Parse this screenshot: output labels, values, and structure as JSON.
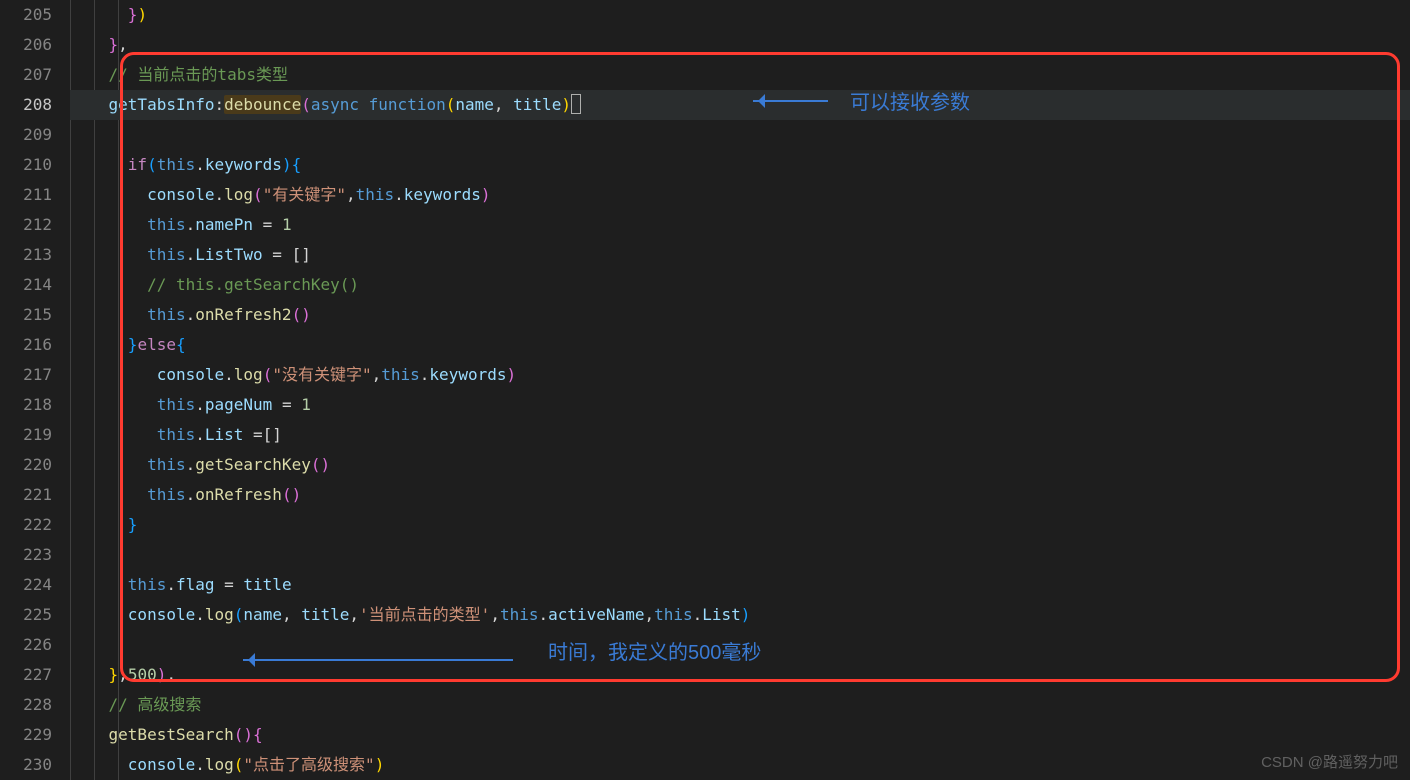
{
  "gutter": {
    "start": 205,
    "end": 230,
    "active": 208
  },
  "code": {
    "l205": "      })",
    "l206": "    },",
    "comment1": "// 当前点击的tabs类型",
    "l208_key": "getTabsInfo",
    "l208_fn": "debounce",
    "l208_async": "async",
    "l208_function": "function",
    "l208_p1": "name",
    "l208_p2": "title",
    "l210_if": "if",
    "l210_this": "this",
    "l210_kw": "keywords",
    "l211_console": "console",
    "l211_log": "log",
    "l211_str": "\"有关键字\"",
    "l211_this": "this",
    "l211_kw": "keywords",
    "l212_this": "this",
    "l212_prop": "namePn",
    "l212_eq": " = ",
    "l212_val": "1",
    "l213_this": "this",
    "l213_prop": "ListTwo",
    "l213_eq": " = ",
    "l213_val": "[]",
    "l214_comment": "// this.getSearchKey()",
    "l215_this": "this",
    "l215_fn": "onRefresh2",
    "l216_else": "else",
    "l217_console": "console",
    "l217_log": "log",
    "l217_str": "\"没有关键字\"",
    "l217_this": "this",
    "l217_kw": "keywords",
    "l218_this": "this",
    "l218_prop": "pageNum",
    "l218_eq": " = ",
    "l218_val": "1",
    "l219_this": "this",
    "l219_prop": "List",
    "l219_eq": " =",
    "l219_val": "[]",
    "l220_this": "this",
    "l220_fn": "getSearchKey",
    "l221_this": "this",
    "l221_fn": "onRefresh",
    "l224_this": "this",
    "l224_prop": "flag",
    "l224_eq": " = ",
    "l224_val": "title",
    "l225_console": "console",
    "l225_log": "log",
    "l225_p1": "name",
    "l225_p2": "title",
    "l225_str": "'当前点击的类型'",
    "l225_this1": "this",
    "l225_prop1": "activeName",
    "l225_this2": "this",
    "l225_prop2": "List",
    "l227_num": "500",
    "comment2": "// 高级搜索",
    "l229_fn": "getBestSearch",
    "l230_console": "console",
    "l230_log": "log",
    "l230_str": "\"点击了高级搜索\""
  },
  "annotations": {
    "a1": "可以接收参数",
    "a2": "时间，我定义的500毫秒"
  },
  "watermark": "CSDN @路遥努力吧"
}
